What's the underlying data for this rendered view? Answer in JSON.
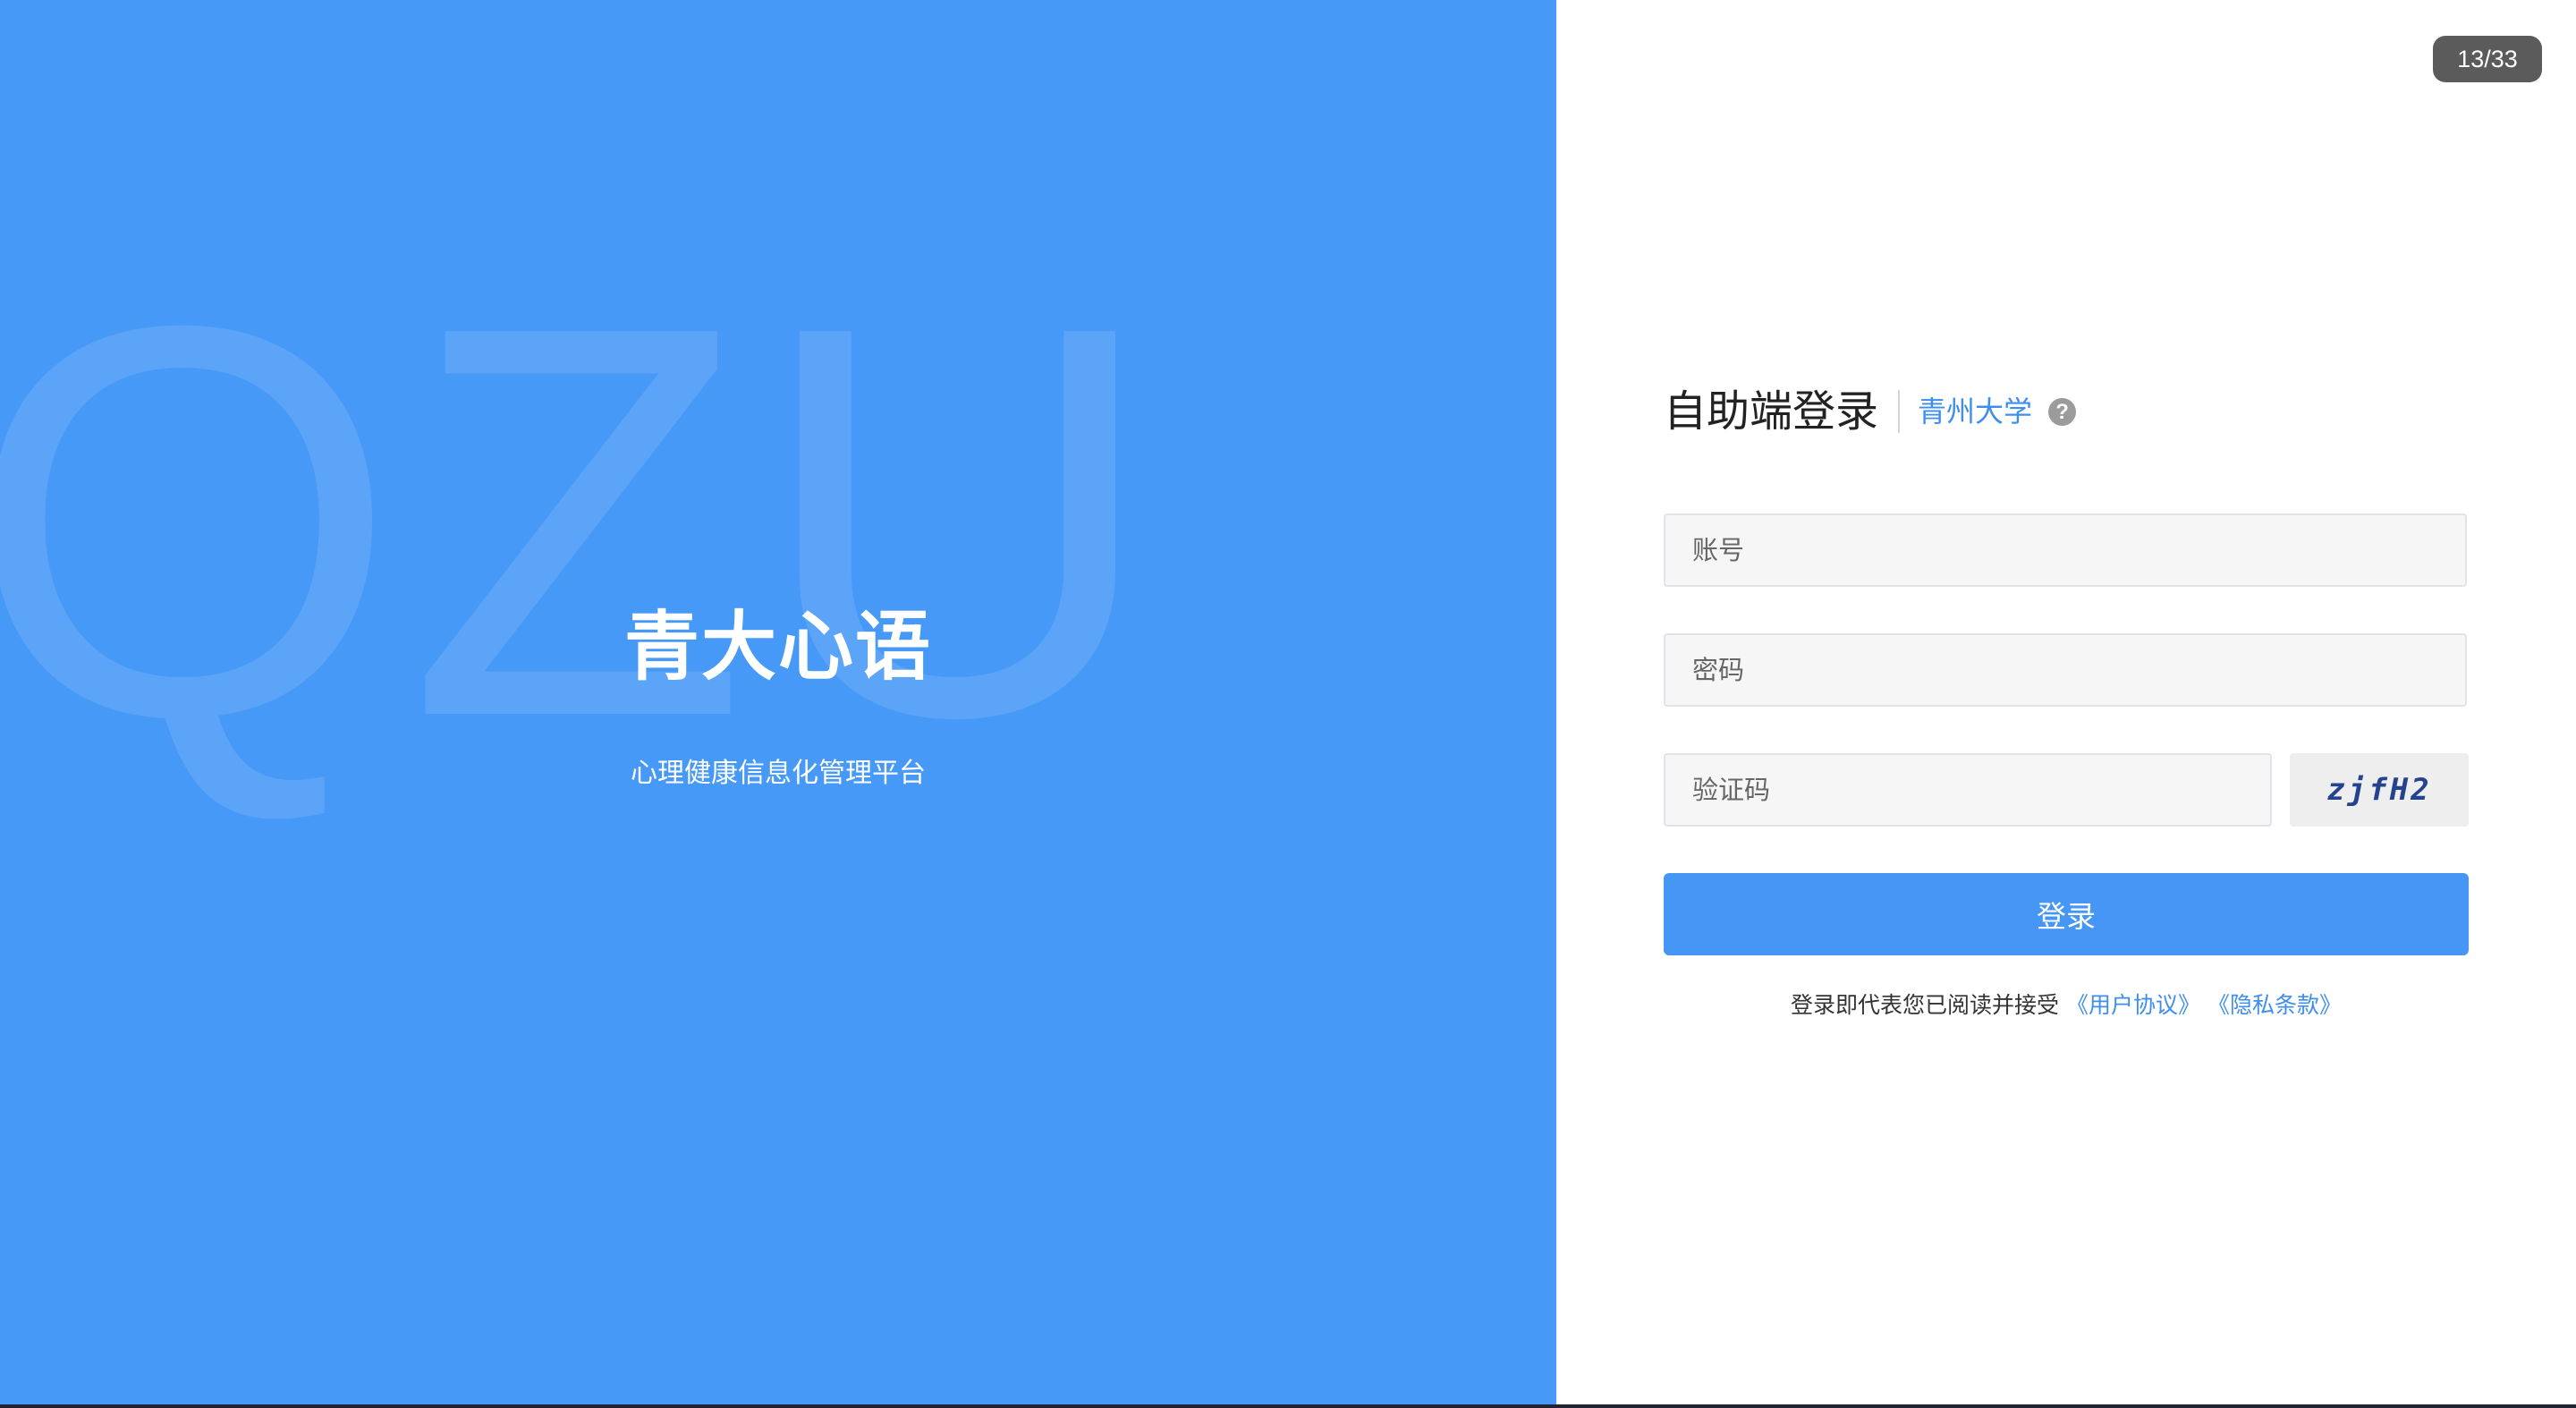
{
  "left_panel": {
    "watermark": "QZU",
    "brand_title": "青大心语",
    "brand_subtitle": "心理健康信息化管理平台"
  },
  "page_counter": "13/33",
  "login": {
    "title": "自助端登录",
    "school": "青州大学",
    "help_icon": "?",
    "account_placeholder": "账号",
    "password_placeholder": "密码",
    "captcha_placeholder": "验证码",
    "captcha_text": "zjfH2",
    "submit_label": "登录",
    "agreement_text": "登录即代表您已阅读并接受",
    "user_agreement_link": "《用户协议》",
    "privacy_policy_link": "《隐私条款》"
  },
  "colors": {
    "brand_blue": "#4799f7",
    "link_blue": "#3d8eed",
    "button_blue": "#4596f5"
  },
  "icons": {
    "help": "help-icon"
  }
}
